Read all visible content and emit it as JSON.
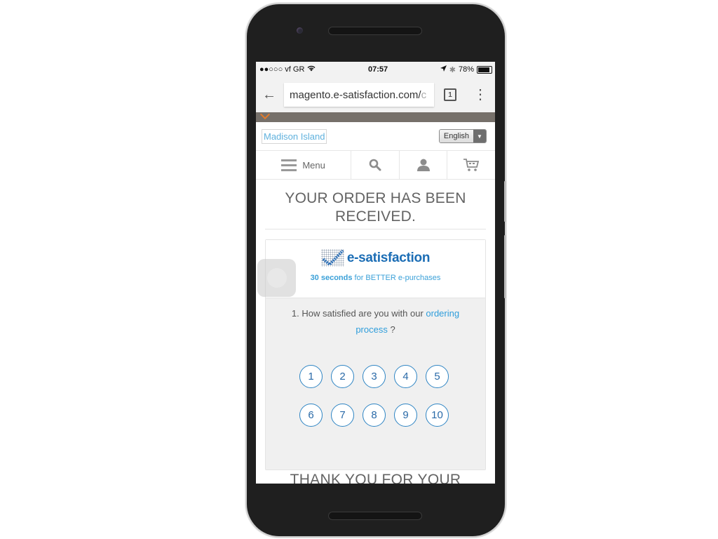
{
  "status_bar": {
    "carrier": "●●○○○ vf GR",
    "time": "07:57",
    "battery": "78%",
    "battery_level": 0.78
  },
  "browser": {
    "url": "magento.e-satisfaction.com/",
    "url_fade": "c",
    "tab_count": "1"
  },
  "store": {
    "logo": "Madison Island",
    "language": "English"
  },
  "nav": {
    "menu_label": "Menu"
  },
  "page": {
    "title": "YOUR ORDER HAS BEEN RECEIVED.",
    "footer_text": "THANK YOU FOR YOUR"
  },
  "survey": {
    "brand": "e-satisfaction",
    "tagline_bold": "30 seconds",
    "tagline_rest": " for BETTER e-purchases",
    "question_prefix": "1. How satisfied are you with our ",
    "question_link": "ordering process",
    "question_suffix": " ?",
    "scale": [
      "1",
      "2",
      "3",
      "4",
      "5",
      "6",
      "7",
      "8",
      "9",
      "10"
    ],
    "colors": {
      "brand": "#1b6db5",
      "accent": "#2e9ddb"
    }
  }
}
